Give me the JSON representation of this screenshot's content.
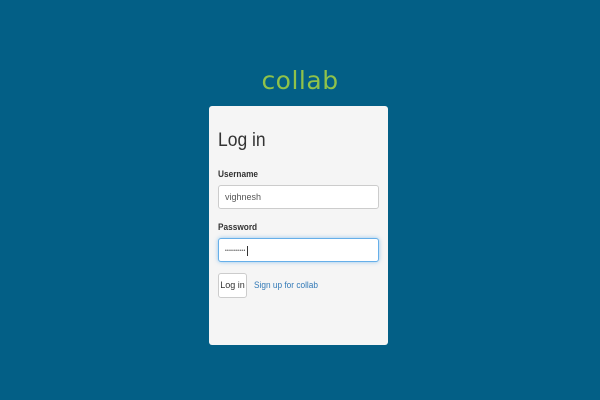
{
  "app": {
    "logo_text": "collab"
  },
  "login_form": {
    "title": "Log in",
    "username_label": "Username",
    "username_value": "vighnesh",
    "password_label": "Password",
    "password_value": "••••••••••",
    "submit_label": "Log in",
    "signup_link_label": "Sign up for collab"
  },
  "colors": {
    "background": "#035f86",
    "logo": "#8fc24a",
    "panel": "#f5f5f5",
    "link": "#337ab7",
    "focus_border": "#66afe9"
  }
}
